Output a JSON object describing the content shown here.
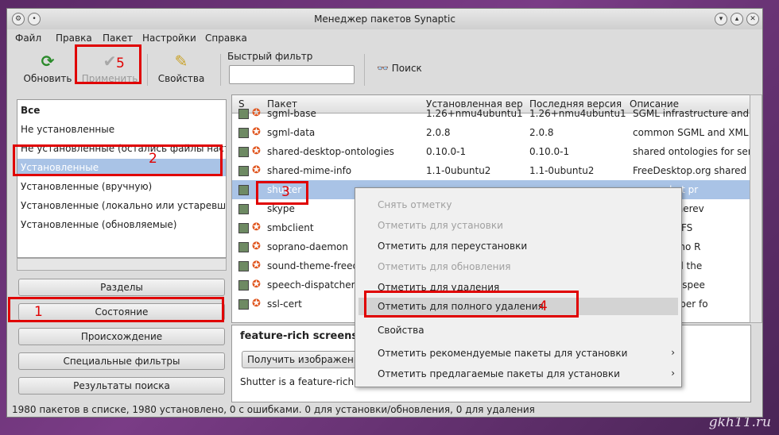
{
  "window": {
    "title": "Менеджер пакетов Synaptic"
  },
  "menubar": [
    "Файл",
    "Правка",
    "Пакет",
    "Настройки",
    "Справка"
  ],
  "toolbar": {
    "reload_label": "Обновить",
    "apply_label": "Применить",
    "properties_label": "Свойства",
    "quick_filter_label": "Быстрый фильтр",
    "quick_filter_value": "",
    "search_label": "Поиск"
  },
  "left_list": [
    "Все",
    "Не установленные",
    "Не установленные (остались файлы настро",
    "Установленные",
    "Установленные (вручную)",
    "Установленные (локально или устаревшие",
    "Установленные (обновляемые)"
  ],
  "nav_buttons": [
    "Разделы",
    "Состояние",
    "Происхождение",
    "Специальные фильтры",
    "Результаты поиска"
  ],
  "table": {
    "headers": [
      "Пакет",
      "Установленная вер",
      "Последняя версия",
      "Описание"
    ],
    "rows": [
      {
        "name": "sgml-base",
        "installed": "1.26+nmu4ubuntu1",
        "latest": "1.26+nmu4ubuntu1",
        "desc": "SGML infrastructure and S"
      },
      {
        "name": "sgml-data",
        "installed": "2.0.8",
        "latest": "2.0.8",
        "desc": "common SGML and XML d"
      },
      {
        "name": "shared-desktop-ontologies",
        "installed": "0.10.0-1",
        "latest": "0.10.0-1",
        "desc": "shared ontologies for sem"
      },
      {
        "name": "shared-mime-info",
        "installed": "1.1-0ubuntu2",
        "latest": "1.1-0ubuntu2",
        "desc": "FreeDesktop.org shared M"
      },
      {
        "name": "shutter",
        "installed": "",
        "latest": "",
        "desc": "screenshot pr"
      },
      {
        "name": "skype",
        "installed": "",
        "latest": "",
        "desc": "ou are, wherev"
      },
      {
        "name": "smbclient",
        "installed": "",
        "latest": "",
        "desc": "ne SMB/CIFS"
      },
      {
        "name": "soprano-daemon",
        "installed": "",
        "latest": "",
        "desc": "the Soprano R"
      },
      {
        "name": "sound-theme-freedes",
        "installed": "",
        "latest": "",
        "desc": ".org sound the"
      },
      {
        "name": "speech-dispatcher",
        "installed": "",
        "latest": "",
        "desc": "terface to spee"
      },
      {
        "name": "ssl-cert",
        "installed": "",
        "latest": "",
        "desc": "conf wrapper fo"
      }
    ]
  },
  "details": {
    "title": "feature-rich screensh",
    "screenshot_button": "Получить изображение",
    "text": "Shutter is a feature-rich s"
  },
  "context_menu": [
    {
      "label": "Снять отметку",
      "enabled": false
    },
    {
      "label": "Отметить для установки",
      "enabled": false
    },
    {
      "label": "Отметить для переустановки",
      "enabled": true
    },
    {
      "label": "Отметить для обновления",
      "enabled": false
    },
    {
      "label": "Отметить для удаления",
      "enabled": true
    },
    {
      "label": "Отметить для полного удаления",
      "enabled": true
    },
    {
      "label": "Свойства",
      "enabled": true
    },
    {
      "label": "Отметить рекомендуемые пакеты для установки",
      "enabled": true,
      "submenu": true
    },
    {
      "label": "Отметить предлагаемые пакеты для установки",
      "enabled": true,
      "submenu": true
    }
  ],
  "statusbar": "1980 пакетов в списке, 1980 установлено, 0 с ошибками. 0 для установки/обновления, 0 для удаления",
  "annotations": [
    "1",
    "2",
    "3",
    "4",
    "5"
  ],
  "watermark": "gkh11.ru",
  "colors": {
    "selection": "#a9c3e6",
    "annotation": "#e00000",
    "ubuntu_icon": "#e0561f"
  }
}
